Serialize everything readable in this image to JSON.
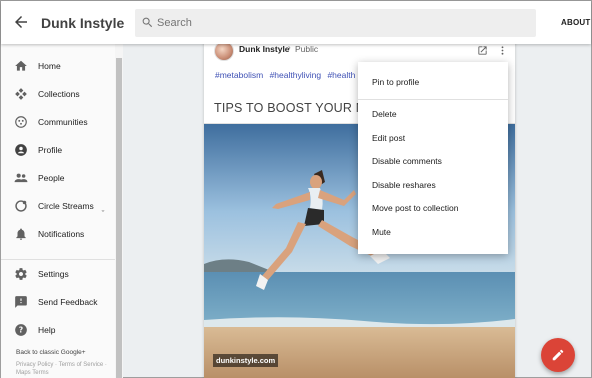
{
  "header": {
    "title": "Dunk Instyle",
    "search_placeholder": "Search",
    "about_label": "ABOUT"
  },
  "sidebar": {
    "items": [
      {
        "label": "Home",
        "icon": "home-icon"
      },
      {
        "label": "Collections",
        "icon": "collections-icon"
      },
      {
        "label": "Communities",
        "icon": "communities-icon"
      },
      {
        "label": "Profile",
        "icon": "profile-icon"
      },
      {
        "label": "People",
        "icon": "people-icon"
      },
      {
        "label": "Circle Streams",
        "icon": "circle-streams-icon"
      },
      {
        "label": "Notifications",
        "icon": "bell-icon"
      },
      {
        "label": "Settings",
        "icon": "gear-icon"
      },
      {
        "label": "Send Feedback",
        "icon": "feedback-icon"
      },
      {
        "label": "Help",
        "icon": "help-icon"
      }
    ],
    "classic_link": "Back to classic Google+",
    "footer_text": "Privacy Policy · Terms of Service · Maps Terms"
  },
  "post": {
    "author": "Dunk Instyle",
    "separator": "›",
    "visibility": "Public",
    "hashtags": [
      "#metabolism",
      "#healthyliving",
      "#health"
    ],
    "title": "TIPS TO BOOST YOUR METABOLISM",
    "watermark": "dunkinstyle.com"
  },
  "menu": {
    "items": [
      "Pin to profile",
      "Delete",
      "Edit post",
      "Disable comments",
      "Disable reshares",
      "Move post to collection",
      "Mute"
    ]
  },
  "colors": {
    "accent": "#3f51b5",
    "fab": "#db4437"
  }
}
